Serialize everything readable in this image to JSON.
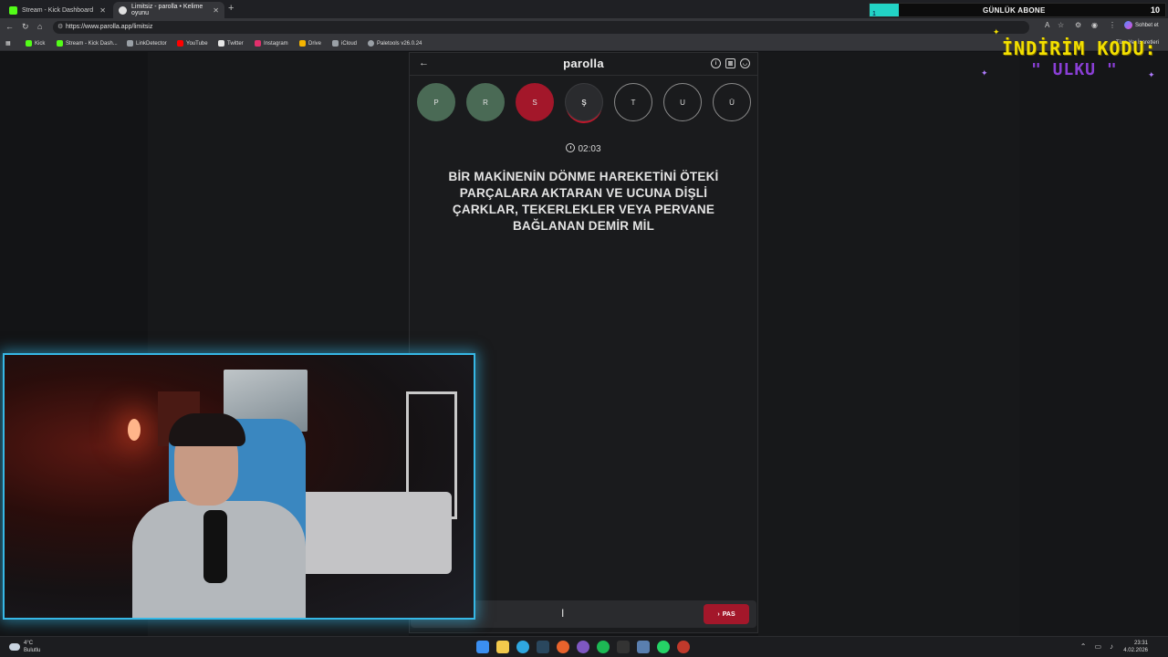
{
  "browser": {
    "tabs": [
      {
        "title": "Stream - Kick Dashboard",
        "favicon_color": "#53fc18"
      },
      {
        "title": "Limitsiz - parolla • Kelime oyunu",
        "favicon_color": "#e0e0e0"
      }
    ],
    "url": "https://www.parolla.app/limitsiz",
    "chat_label": "Sohbet et",
    "bookmarks": [
      {
        "label": "Kick",
        "color": "#53fc18"
      },
      {
        "label": "Stream - Kick Dash...",
        "color": "#53fc18"
      },
      {
        "label": "LinkDetector",
        "color": "#9aa0a6"
      },
      {
        "label": "YouTube",
        "color": "#ff0000"
      },
      {
        "label": "Twitter",
        "color": "#e6e6e6"
      },
      {
        "label": "Instagram",
        "color": "#e1306c"
      },
      {
        "label": "Drive",
        "color": "#f4b400"
      },
      {
        "label": "iCloud",
        "color": "#9aa0a6"
      },
      {
        "label": "Paletools v26.0.24",
        "color": "#9aa0a6"
      }
    ],
    "bookmarks_right": "Tüm Yer İşaretleri"
  },
  "overlay": {
    "abone_label": "GÜNLÜK ABONE",
    "abone_current": "1",
    "abone_goal": "10",
    "abone_progress": 0.1,
    "promo_title": "İNDİRİM KODU:",
    "promo_code": "\" ULKU \"",
    "colors": {
      "promo_title": "#f3e000",
      "promo_code": "#8a3fd6",
      "webcam_border": "#36b8e6"
    }
  },
  "app": {
    "logo": "parolla",
    "header_icons": [
      "info-icon",
      "stats-icon",
      "user-icon"
    ],
    "letters": [
      {
        "char": "P",
        "state": "correct"
      },
      {
        "char": "R",
        "state": "correct"
      },
      {
        "char": "S",
        "state": "wrong"
      },
      {
        "char": "Ş",
        "state": "current"
      },
      {
        "char": "T",
        "state": "pending"
      },
      {
        "char": "U",
        "state": "pending"
      },
      {
        "char": "Ü",
        "state": "pending"
      }
    ],
    "timer": "02:03",
    "question": "BİR MAKİNENİN DÖNME HAREKETİNİ ÖTEKİ PARÇALARA AKTARAN VE UCUNA DİŞLİ ÇARKLAR, TEKERLEKLER VEYA PERVANE BAĞLANAN DEMİR MİL",
    "answer_placeholder": "",
    "pass_label": "PAS",
    "colors": {
      "correct": "#4a6a55",
      "wrong": "#a3172a",
      "pass": "#a3172a"
    }
  },
  "taskbar": {
    "weather_temp": "4°C",
    "weather_desc": "Bulutlu",
    "time": "23:31",
    "date": "4.02.2026"
  }
}
